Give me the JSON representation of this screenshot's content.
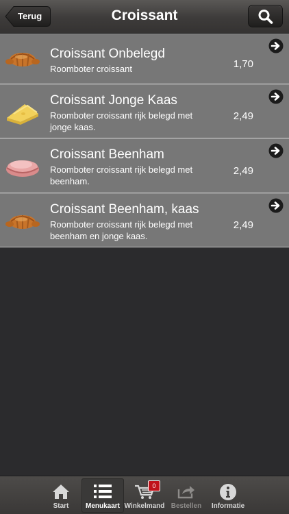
{
  "header": {
    "back_label": "Terug",
    "title": "Croissant",
    "search_icon": "search-icon"
  },
  "items": [
    {
      "name": "Croissant Onbelegd",
      "desc": "Roomboter croissant",
      "price": "1,70",
      "image": "croissant"
    },
    {
      "name": "Croissant Jonge Kaas",
      "desc": "Roomboter croissant rijk belegd met jonge kaas.",
      "price": "2,49",
      "image": "cheese"
    },
    {
      "name": "Croissant Beenham",
      "desc": "Roomboter croissant rijk belegd met beenham.",
      "price": "2,49",
      "image": "ham"
    },
    {
      "name": "Croissant Beenham, kaas",
      "desc": "Roomboter croissant rijk belegd met beenham en jonge kaas.",
      "price": "2,49",
      "image": "croissant"
    }
  ],
  "tabbar": {
    "tabs": [
      {
        "label": "Start",
        "icon": "home-icon"
      },
      {
        "label": "Menukaart",
        "icon": "list-icon"
      },
      {
        "label": "Winkelmand",
        "icon": "cart-icon",
        "badge": "0"
      },
      {
        "label": "Bestellen",
        "icon": "share-icon"
      },
      {
        "label": "Informatie",
        "icon": "info-icon"
      }
    ],
    "active": "Menukaart"
  },
  "colors": {
    "row_bg": "#777777",
    "header_bg": "#3d3b3a",
    "badge": "#c0131a",
    "body_bg": "#2b2b2d"
  }
}
